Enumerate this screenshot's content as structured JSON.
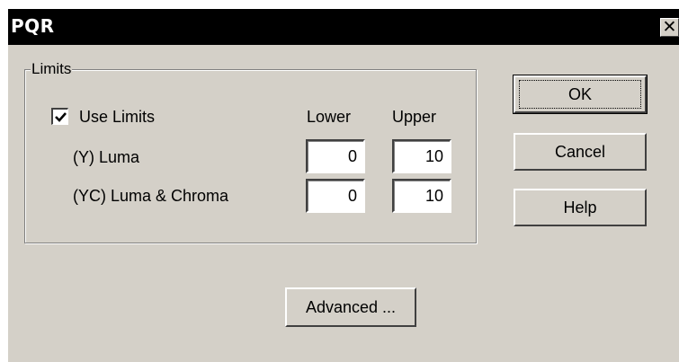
{
  "window": {
    "title": "PQR",
    "close_glyph": "✕"
  },
  "limits": {
    "group_label": "Limits",
    "use_limits_label": "Use Limits",
    "use_limits_checked": true,
    "lower_header": "Lower",
    "upper_header": "Upper",
    "rows": [
      {
        "label": "(Y) Luma",
        "lower": "0",
        "upper": "10"
      },
      {
        "label": "(YC) Luma & Chroma",
        "lower": "0",
        "upper": "10"
      }
    ]
  },
  "buttons": {
    "ok": "OK",
    "cancel": "Cancel",
    "help": "Help",
    "advanced": "Advanced ..."
  },
  "colors": {
    "dialog_face": "#d4d0c8",
    "titlebar": "#000000"
  }
}
